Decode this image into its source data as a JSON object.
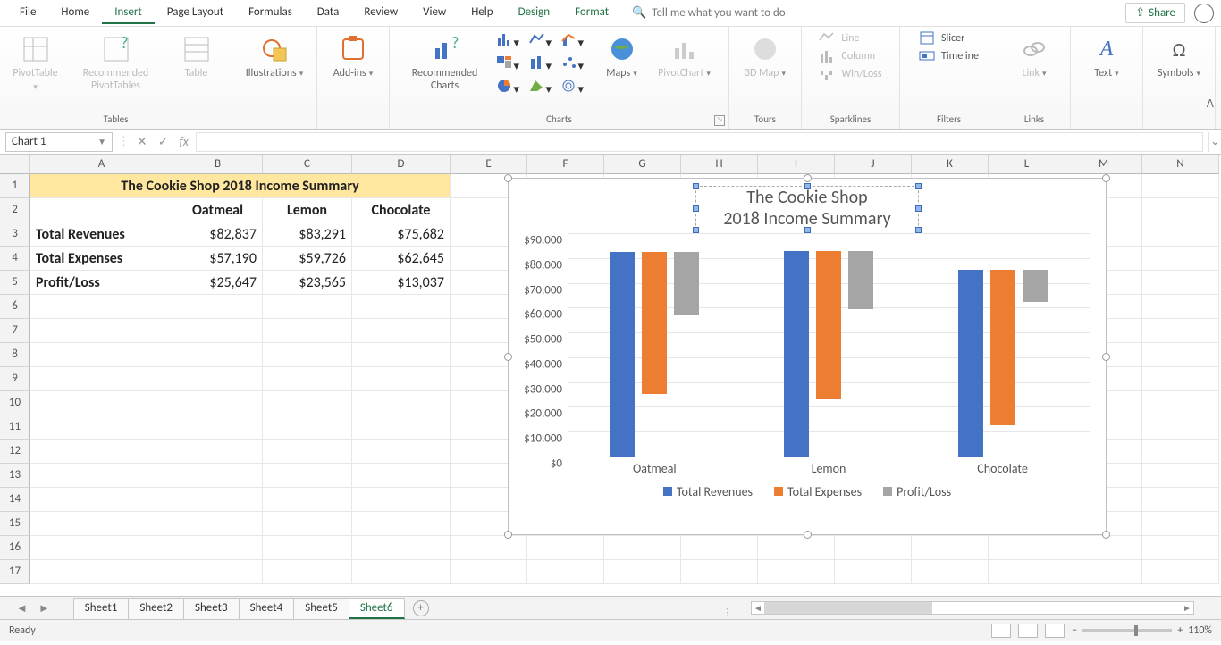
{
  "menu": {
    "tabs": [
      "File",
      "Home",
      "Insert",
      "Page Layout",
      "Formulas",
      "Data",
      "Review",
      "View",
      "Help",
      "Design",
      "Format"
    ],
    "active": "Insert",
    "context_start": 9,
    "tellme": "Tell me what you want to do",
    "share": "Share"
  },
  "ribbon": {
    "tables": {
      "pivottable": "PivotTable",
      "recpivot": "Recommended PivotTables",
      "table": "Table",
      "label": "Tables"
    },
    "illus": {
      "btn": "Illustrations",
      "label": ""
    },
    "addins": {
      "btn": "Add-ins",
      "label": ""
    },
    "charts": {
      "rec": "Recommended Charts",
      "maps": "Maps",
      "pivotchart": "PivotChart",
      "label": "Charts"
    },
    "tours": {
      "map3d": "3D Map",
      "label": "Tours"
    },
    "sparks": {
      "line": "Line",
      "column": "Column",
      "winloss": "Win/Loss",
      "label": "Sparklines"
    },
    "filters": {
      "slicer": "Slicer",
      "timeline": "Timeline",
      "label": "Filters"
    },
    "links": {
      "link": "Link",
      "label": "Links"
    },
    "text": {
      "btn": "Text"
    },
    "symbols": {
      "btn": "Symbols"
    }
  },
  "namebox": "Chart 1",
  "columns": [
    "A",
    "B",
    "C",
    "D",
    "E",
    "F",
    "G",
    "H",
    "I",
    "J",
    "K",
    "L",
    "M",
    "N"
  ],
  "data_table": {
    "title": "The Cookie Shop 2018 Income Summary",
    "col_headers": [
      "Oatmeal",
      "Lemon",
      "Chocolate"
    ],
    "rows": [
      {
        "label": "Total Revenues",
        "vals": [
          "$82,837",
          "$83,291",
          "$75,682"
        ]
      },
      {
        "label": "Total Expenses",
        "vals": [
          "$57,190",
          "$59,726",
          "$62,645"
        ]
      },
      {
        "label": "Profit/Loss",
        "vals": [
          "$25,647",
          "$23,565",
          "$13,037"
        ]
      }
    ]
  },
  "chart_data": {
    "type": "bar",
    "categories": [
      "Oatmeal",
      "Lemon",
      "Chocolate"
    ],
    "series": [
      {
        "name": "Total Revenues",
        "values": [
          82837,
          83291,
          75682
        ],
        "color": "#4472c4"
      },
      {
        "name": "Total Expenses",
        "values": [
          57190,
          59726,
          62645
        ],
        "color": "#ed7d31"
      },
      {
        "name": "Profit/Loss",
        "values": [
          25647,
          23565,
          13037
        ],
        "color": "#a5a5a5"
      }
    ],
    "title": "The Cookie Shop\n2018 Income Summary",
    "title_line1": "The Cookie Shop",
    "title_line2": "2018 Income Summary",
    "ylim": [
      0,
      90000
    ],
    "ystep": 10000,
    "yticks": [
      "$0",
      "$10,000",
      "$20,000",
      "$30,000",
      "$40,000",
      "$50,000",
      "$60,000",
      "$70,000",
      "$80,000",
      "$90,000"
    ]
  },
  "sheets": {
    "list": [
      "Sheet1",
      "Sheet2",
      "Sheet3",
      "Sheet4",
      "Sheet5",
      "Sheet6"
    ],
    "active": "Sheet6"
  },
  "status": {
    "ready": "Ready",
    "zoom": "110%"
  }
}
